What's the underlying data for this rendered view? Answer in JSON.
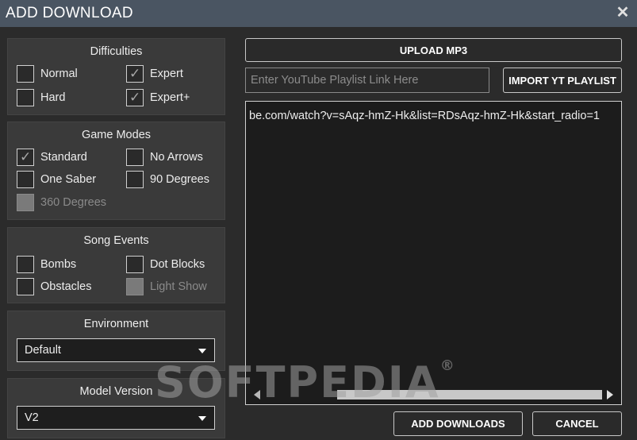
{
  "window": {
    "title": "ADD DOWNLOAD",
    "close_glyph": "✕"
  },
  "difficulties": {
    "title": "Difficulties",
    "items": [
      {
        "label": "Normal",
        "checked": false,
        "disabled": false
      },
      {
        "label": "Expert",
        "checked": true,
        "disabled": false
      },
      {
        "label": "Hard",
        "checked": false,
        "disabled": false
      },
      {
        "label": "Expert+",
        "checked": true,
        "disabled": false
      }
    ]
  },
  "game_modes": {
    "title": "Game Modes",
    "items": [
      {
        "label": "Standard",
        "checked": true,
        "disabled": false
      },
      {
        "label": "No Arrows",
        "checked": false,
        "disabled": false
      },
      {
        "label": "One Saber",
        "checked": false,
        "disabled": false
      },
      {
        "label": "90 Degrees",
        "checked": false,
        "disabled": false
      },
      {
        "label": "360 Degrees",
        "checked": false,
        "disabled": true
      }
    ]
  },
  "song_events": {
    "title": "Song Events",
    "items": [
      {
        "label": "Bombs",
        "checked": false,
        "disabled": false
      },
      {
        "label": "Dot Blocks",
        "checked": false,
        "disabled": false
      },
      {
        "label": "Obstacles",
        "checked": false,
        "disabled": false
      },
      {
        "label": "Light Show",
        "checked": false,
        "disabled": true
      }
    ]
  },
  "environment": {
    "title": "Environment",
    "selected": "Default"
  },
  "model_version": {
    "title": "Model Version",
    "selected": "V2"
  },
  "upload_button": "UPLOAD MP3",
  "playlist_input": {
    "placeholder": "Enter YouTube Playlist Link Here",
    "value": ""
  },
  "import_button": "IMPORT YT PLAYLIST",
  "links_text": "be.com/watch?v=sAqz-hmZ-Hk&list=RDsAqz-hmZ-Hk&start_radio=1",
  "add_button": "ADD DOWNLOADS",
  "cancel_button": "CANCEL",
  "watermark": {
    "text": "SOFTPEDIA",
    "mark": "®"
  },
  "colors": {
    "titlebar": "#4a5562",
    "background": "#2b2b2b",
    "panel": "#3a3a3a"
  }
}
